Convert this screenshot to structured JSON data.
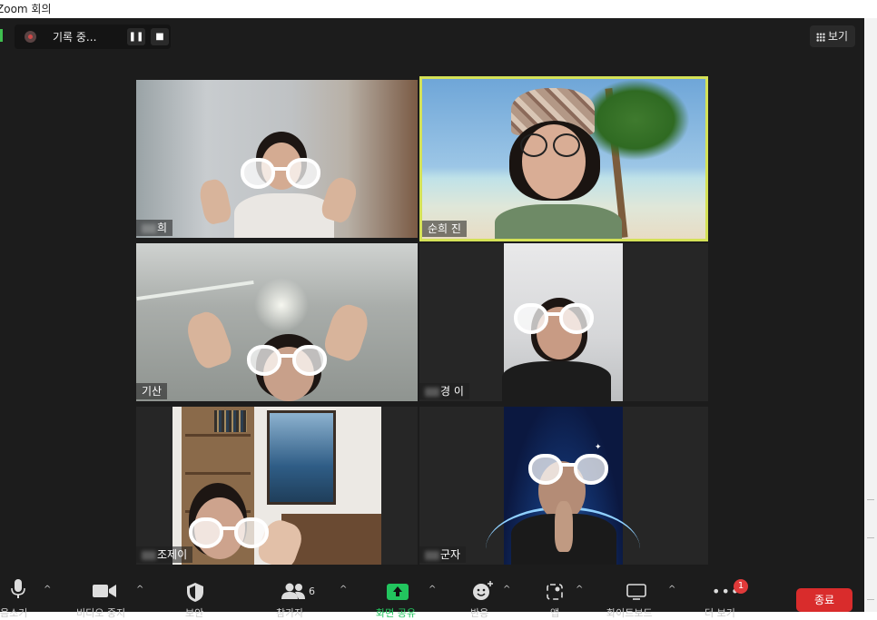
{
  "window": {
    "title": "Zoom 회의"
  },
  "recording": {
    "label": "기록 중...",
    "pause_icon": "pause-icon",
    "stop_icon": "stop-icon"
  },
  "view_button": {
    "label": "보기"
  },
  "participants": [
    {
      "name": "희",
      "active_speaker": false
    },
    {
      "name": "순희 진",
      "active_speaker": true
    },
    {
      "name": "기산",
      "active_speaker": false
    },
    {
      "name": "경 이",
      "active_speaker": false
    },
    {
      "name": "조제이",
      "active_speaker": false
    },
    {
      "name": "군자",
      "active_speaker": false
    }
  ],
  "toolbar": {
    "items": [
      {
        "label": "음소거",
        "icon": "microphone-icon"
      },
      {
        "label": "비디오 중지",
        "icon": "video-camera-icon"
      },
      {
        "label": "보안",
        "icon": "shield-icon"
      },
      {
        "label": "참가자",
        "icon": "participants-icon",
        "count": "6"
      },
      {
        "label": "화면 공유",
        "icon": "share-screen-icon"
      },
      {
        "label": "반응",
        "icon": "reaction-icon"
      },
      {
        "label": "앱",
        "icon": "apps-icon"
      },
      {
        "label": "화이트보드",
        "icon": "whiteboard-icon"
      },
      {
        "label": "더 보기",
        "icon": "more-icon",
        "badge": "1"
      }
    ],
    "end_label": "종료"
  },
  "colors": {
    "active_speaker_border": "#d4e157",
    "end_button": "#d92c2c",
    "share_green": "#22c55e"
  }
}
